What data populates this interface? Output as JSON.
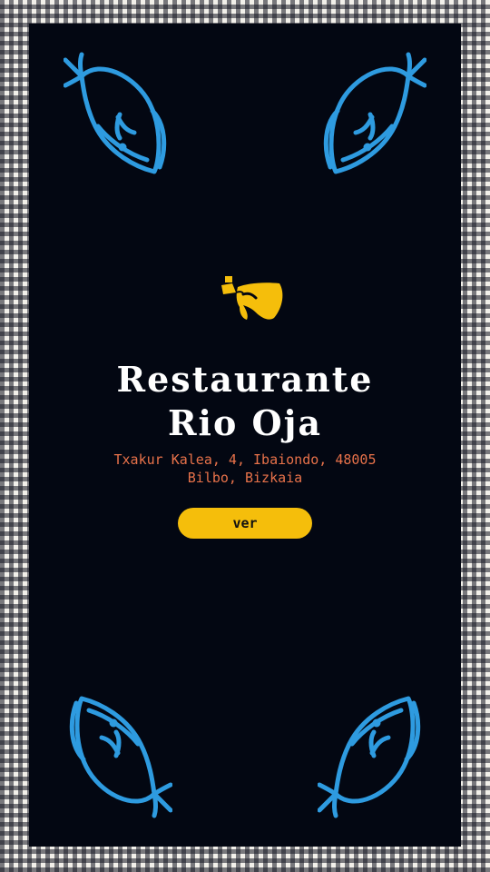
{
  "colors": {
    "background_panel": "#030712",
    "fish_blue": "#2e9be0",
    "accent_yellow": "#f5be0b",
    "address_orange": "#e8724a",
    "title_white": "#ffffff"
  },
  "icons": {
    "logo": "wine-jug-logo-icon",
    "corner": "fish-icon"
  },
  "restaurant": {
    "title_line1": "Restaurante",
    "title_line2": "Rio Oja",
    "address_line1": "Txakur Kalea, 4, Ibaiondo, 48005",
    "address_line2": "Bilbo, Bizkaia"
  },
  "actions": {
    "ver_label": "ver"
  }
}
